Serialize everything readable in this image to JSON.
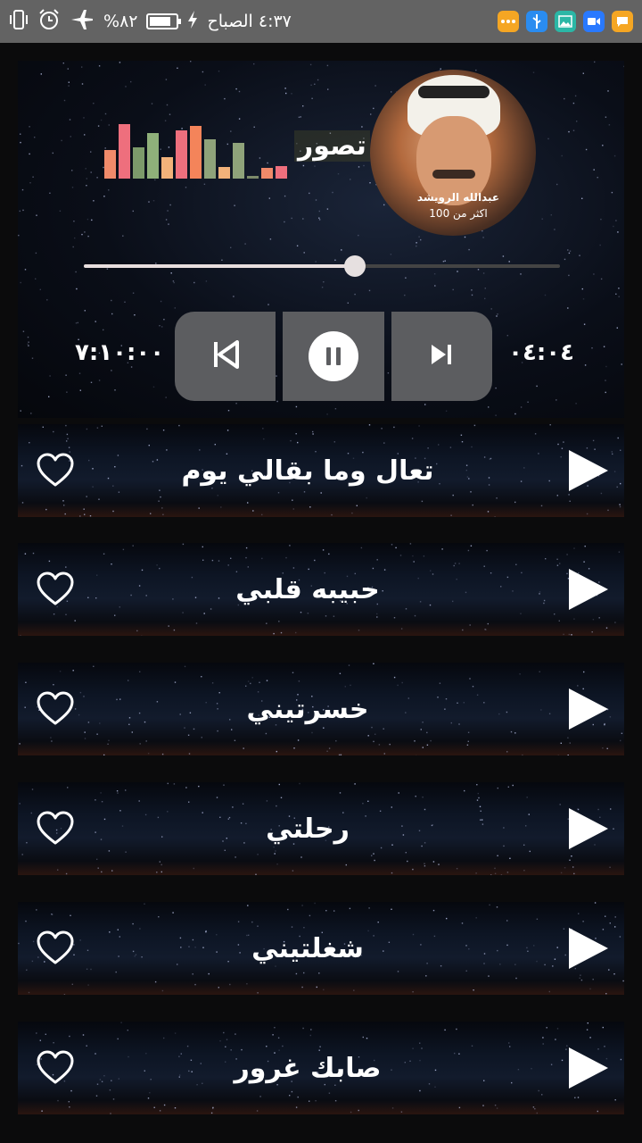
{
  "status_bar": {
    "time": "٤:٣٧ الصباح",
    "battery_text": "%٨٢",
    "battery_level": 0.82,
    "left_icons": [
      "charging-bolt-icon",
      "battery-icon",
      "airplane-mode-icon",
      "alarm-icon",
      "vibrate-icon"
    ],
    "app_icons": [
      {
        "name": "more-app-icon",
        "color": "#f5a623"
      },
      {
        "name": "usb-app-icon",
        "color": "#2a8cf0"
      },
      {
        "name": "gallery-app-icon",
        "color": "#2bb7a6"
      },
      {
        "name": "video-call-app-icon",
        "color": "#2979ff"
      },
      {
        "name": "messages-app-icon",
        "color": "#f5a623"
      }
    ]
  },
  "player": {
    "album_caption_line1": "عبدالله الرويشد",
    "album_caption_line2": "اكثر من 100",
    "now_playing_title": "تصور",
    "equalizer": [
      {
        "level": 0.5,
        "color": "#f08a6a"
      },
      {
        "level": 0.95,
        "color": "#ee6f7d"
      },
      {
        "level": 0.55,
        "color": "#7c9a6a"
      },
      {
        "level": 0.8,
        "color": "#8fb07a"
      },
      {
        "level": 0.38,
        "color": "#f2b27a"
      },
      {
        "level": 0.85,
        "color": "#ee6f7d"
      },
      {
        "level": 0.92,
        "color": "#f4845a"
      },
      {
        "level": 0.68,
        "color": "#8fa37a"
      },
      {
        "level": 0.2,
        "color": "#f2b27a"
      },
      {
        "level": 0.62,
        "color": "#8fa37a"
      },
      {
        "level": 0.05,
        "color": "#7c8a6a"
      },
      {
        "level": 0.18,
        "color": "#f08a6a"
      },
      {
        "level": 0.22,
        "color": "#ee6f7d"
      }
    ],
    "progress": 0.57,
    "elapsed": "٠٤:٠٤",
    "total": "٧:١٠:٠٠",
    "controls": {
      "previous": "previous-icon",
      "pause": "pause-icon",
      "next": "next-icon"
    }
  },
  "songs": [
    {
      "title": "تعال وما بقالي  يوم"
    },
    {
      "title": "حبيبه قلبي"
    },
    {
      "title": "خسرتيني"
    },
    {
      "title": "رحلتي"
    },
    {
      "title": "شغلتيني"
    },
    {
      "title": "صابك غرور"
    }
  ]
}
